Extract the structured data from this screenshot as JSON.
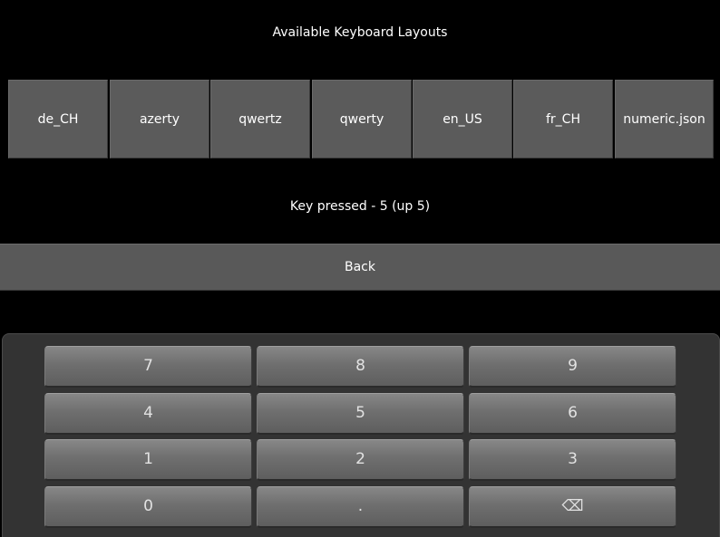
{
  "title": "Available Keyboard Layouts",
  "layouts": [
    "de_CH",
    "azerty",
    "qwertz",
    "qwerty",
    "en_US",
    "fr_CH",
    "numeric.json"
  ],
  "status": "Key pressed - 5 (up 5)",
  "back_label": "Back",
  "keypad": {
    "rows": [
      [
        "7",
        "8",
        "9"
      ],
      [
        "4",
        "5",
        "6"
      ],
      [
        "1",
        "2",
        "3"
      ],
      [
        "0",
        ".",
        "⌫"
      ]
    ],
    "backspace_icon": "backspace-icon"
  },
  "colors": {
    "background": "#000000",
    "button": "#5b5b5b",
    "keyboard_panel": "#333333",
    "key_face": "#777777",
    "text": "#ffffff"
  }
}
